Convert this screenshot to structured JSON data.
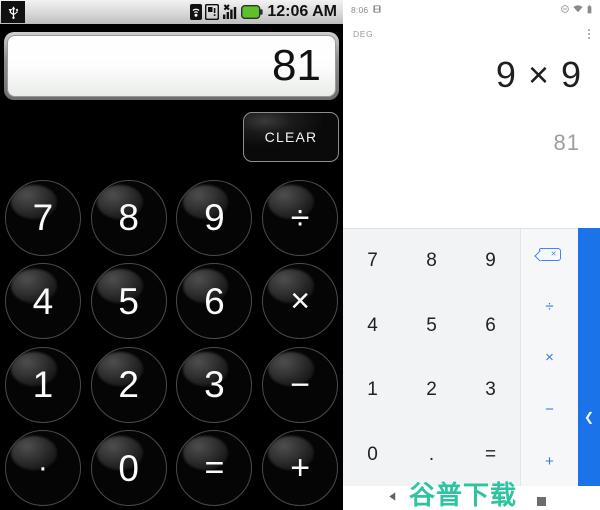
{
  "left_phone": {
    "status_bar": {
      "usb_icon": "usb-icon",
      "icons": [
        "wifi-signal-icon",
        "sd-card-icon",
        "cell-signal-x-icon",
        "battery-icon"
      ],
      "time": "12:06 AM"
    },
    "display": {
      "value": "81"
    },
    "clear_button": {
      "label": "CLEAR"
    },
    "keypad": {
      "rows": [
        [
          {
            "label": "7",
            "name": "key-7",
            "kind": "num"
          },
          {
            "label": "8",
            "name": "key-8",
            "kind": "num"
          },
          {
            "label": "9",
            "name": "key-9",
            "kind": "num"
          },
          {
            "label": "÷",
            "name": "key-divide",
            "kind": "op"
          }
        ],
        [
          {
            "label": "4",
            "name": "key-4",
            "kind": "num"
          },
          {
            "label": "5",
            "name": "key-5",
            "kind": "num"
          },
          {
            "label": "6",
            "name": "key-6",
            "kind": "num"
          },
          {
            "label": "×",
            "name": "key-multiply",
            "kind": "op"
          }
        ],
        [
          {
            "label": "1",
            "name": "key-1",
            "kind": "num"
          },
          {
            "label": "2",
            "name": "key-2",
            "kind": "num"
          },
          {
            "label": "3",
            "name": "key-3",
            "kind": "num"
          },
          {
            "label": "−",
            "name": "key-minus",
            "kind": "op"
          }
        ],
        [
          {
            "label": "·",
            "name": "key-decimal",
            "kind": "dot"
          },
          {
            "label": "0",
            "name": "key-0",
            "kind": "num"
          },
          {
            "label": "=",
            "name": "key-equals",
            "kind": "op"
          },
          {
            "label": "+",
            "name": "key-plus",
            "kind": "op"
          }
        ]
      ]
    }
  },
  "right_phone": {
    "status_bar": {
      "time": "8:06",
      "left_icons": [
        "screenshot-icon"
      ],
      "right_icons": [
        "do-not-disturb-icon",
        "wifi-icon",
        "battery-icon"
      ]
    },
    "top_bar": {
      "angle_mode": "DEG",
      "overflow_menu": "more-options-icon"
    },
    "display": {
      "formula": "9 × 9",
      "result": "81"
    },
    "keypad": {
      "numbers": [
        [
          "7",
          "8",
          "9"
        ],
        [
          "4",
          "5",
          "6"
        ],
        [
          "1",
          "2",
          "3"
        ],
        [
          "0",
          ".",
          "="
        ]
      ],
      "operators": [
        {
          "label": "backspace",
          "name": "key-backspace"
        },
        {
          "label": "÷",
          "name": "key-divide"
        },
        {
          "label": "×",
          "name": "key-multiply"
        },
        {
          "label": "−",
          "name": "key-minus"
        },
        {
          "label": "+",
          "name": "key-plus"
        }
      ],
      "expand_panel": {
        "chevron": "❮"
      }
    },
    "nav_bar": {
      "back": "back-triangle-icon"
    },
    "watermark": {
      "text": "谷普下载"
    }
  },
  "colors": {
    "material_accent": "#1a73e8",
    "operator_blue": "#3b78e7",
    "pad_bg": "#f1f3f4",
    "watermark_green": "#2ec4a0"
  }
}
